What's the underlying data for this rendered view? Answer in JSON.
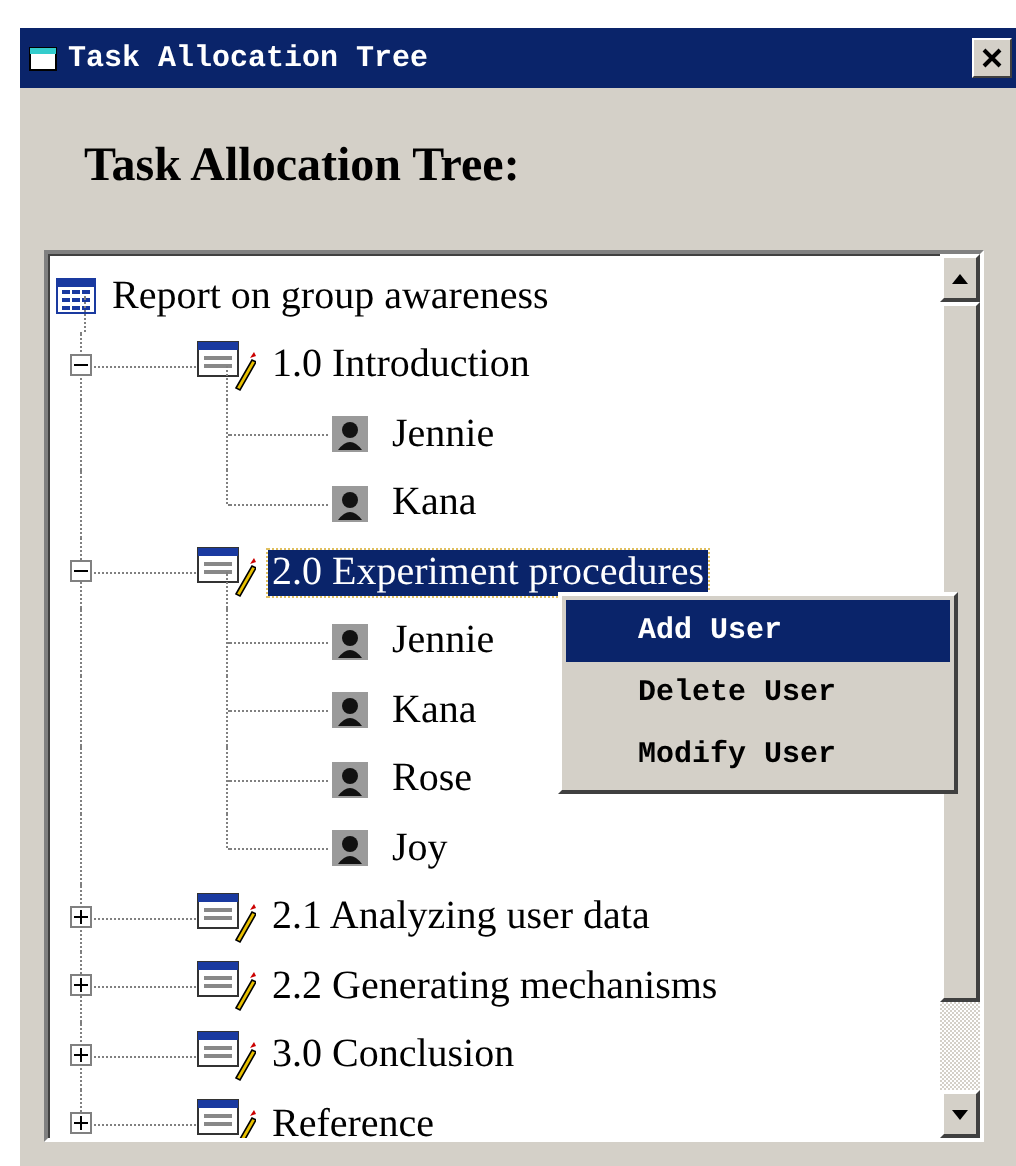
{
  "window": {
    "title": "Task Allocation Tree"
  },
  "heading": "Task Allocation Tree:",
  "tree": {
    "label": "Report on group awareness",
    "children": [
      {
        "label": "1.0 Introduction",
        "expanded": true,
        "selected": false,
        "children": [
          {
            "label": "Jennie"
          },
          {
            "label": "Kana"
          }
        ]
      },
      {
        "label": "2.0 Experiment procedures",
        "expanded": true,
        "selected": true,
        "children": [
          {
            "label": "Jennie"
          },
          {
            "label": "Kana"
          },
          {
            "label": "Rose"
          },
          {
            "label": "Joy"
          }
        ]
      },
      {
        "label": "2.1 Analyzing user data",
        "expanded": false,
        "selected": false
      },
      {
        "label": "2.2 Generating mechanisms",
        "expanded": false,
        "selected": false
      },
      {
        "label": "3.0 Conclusion",
        "expanded": false,
        "selected": false
      },
      {
        "label": "Reference",
        "expanded": false,
        "selected": false
      }
    ]
  },
  "context_menu": [
    {
      "label": "Add User",
      "selected": true
    },
    {
      "label": "Delete User",
      "selected": false
    },
    {
      "label": "Modify User",
      "selected": false
    }
  ]
}
